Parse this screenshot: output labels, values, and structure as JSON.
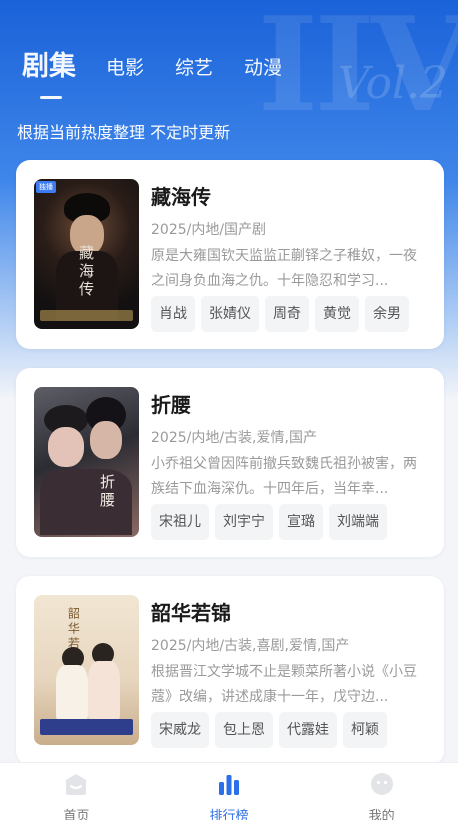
{
  "tabs": [
    {
      "label": "剧集",
      "active": true
    },
    {
      "label": "电影",
      "active": false
    },
    {
      "label": "综艺",
      "active": false
    },
    {
      "label": "动漫",
      "active": false
    }
  ],
  "subtitle": "根据当前热度整理 不定时更新",
  "cards": [
    {
      "title": "藏海传",
      "meta": "2025/内地/国产剧",
      "description": "原是大雍国钦天监监正蒯铎之子稚奴，一夜之间身负血海之仇。十年隐忍和学习...",
      "cast": [
        "肖战",
        "张婧仪",
        "周奇",
        "黄觉",
        "余男"
      ],
      "poster": {
        "title": "藏海传",
        "tag": "独播"
      }
    },
    {
      "title": "折腰",
      "meta": "2025/内地/古装,爱情,国产",
      "description": "小乔祖父曾因阵前撤兵致魏氏祖孙被害，两族结下血海深仇。十四年后，当年幸...",
      "cast": [
        "宋祖儿",
        "刘宇宁",
        "宣璐",
        "刘端端"
      ],
      "poster": {
        "title": "折腰"
      }
    },
    {
      "title": "韶华若锦",
      "meta": "2025/内地/古装,喜剧,爱情,国产",
      "description": "根据晋江文学城不止是颗菜所著小说《小豆蔻》改编，讲述成康十一年，戊守边...",
      "cast": [
        "宋威龙",
        "包上恩",
        "代露娃",
        "柯颖"
      ],
      "poster": {
        "title": "韶华若锦"
      }
    }
  ],
  "bottom_nav": [
    {
      "label": "首页",
      "icon": "home-icon",
      "active": false
    },
    {
      "label": "排行榜",
      "icon": "ranking-icon",
      "active": true
    },
    {
      "label": "我的",
      "icon": "profile-icon",
      "active": false
    }
  ],
  "colors": {
    "accent": "#2d6fe8",
    "header_blue": "#1a62d8"
  }
}
